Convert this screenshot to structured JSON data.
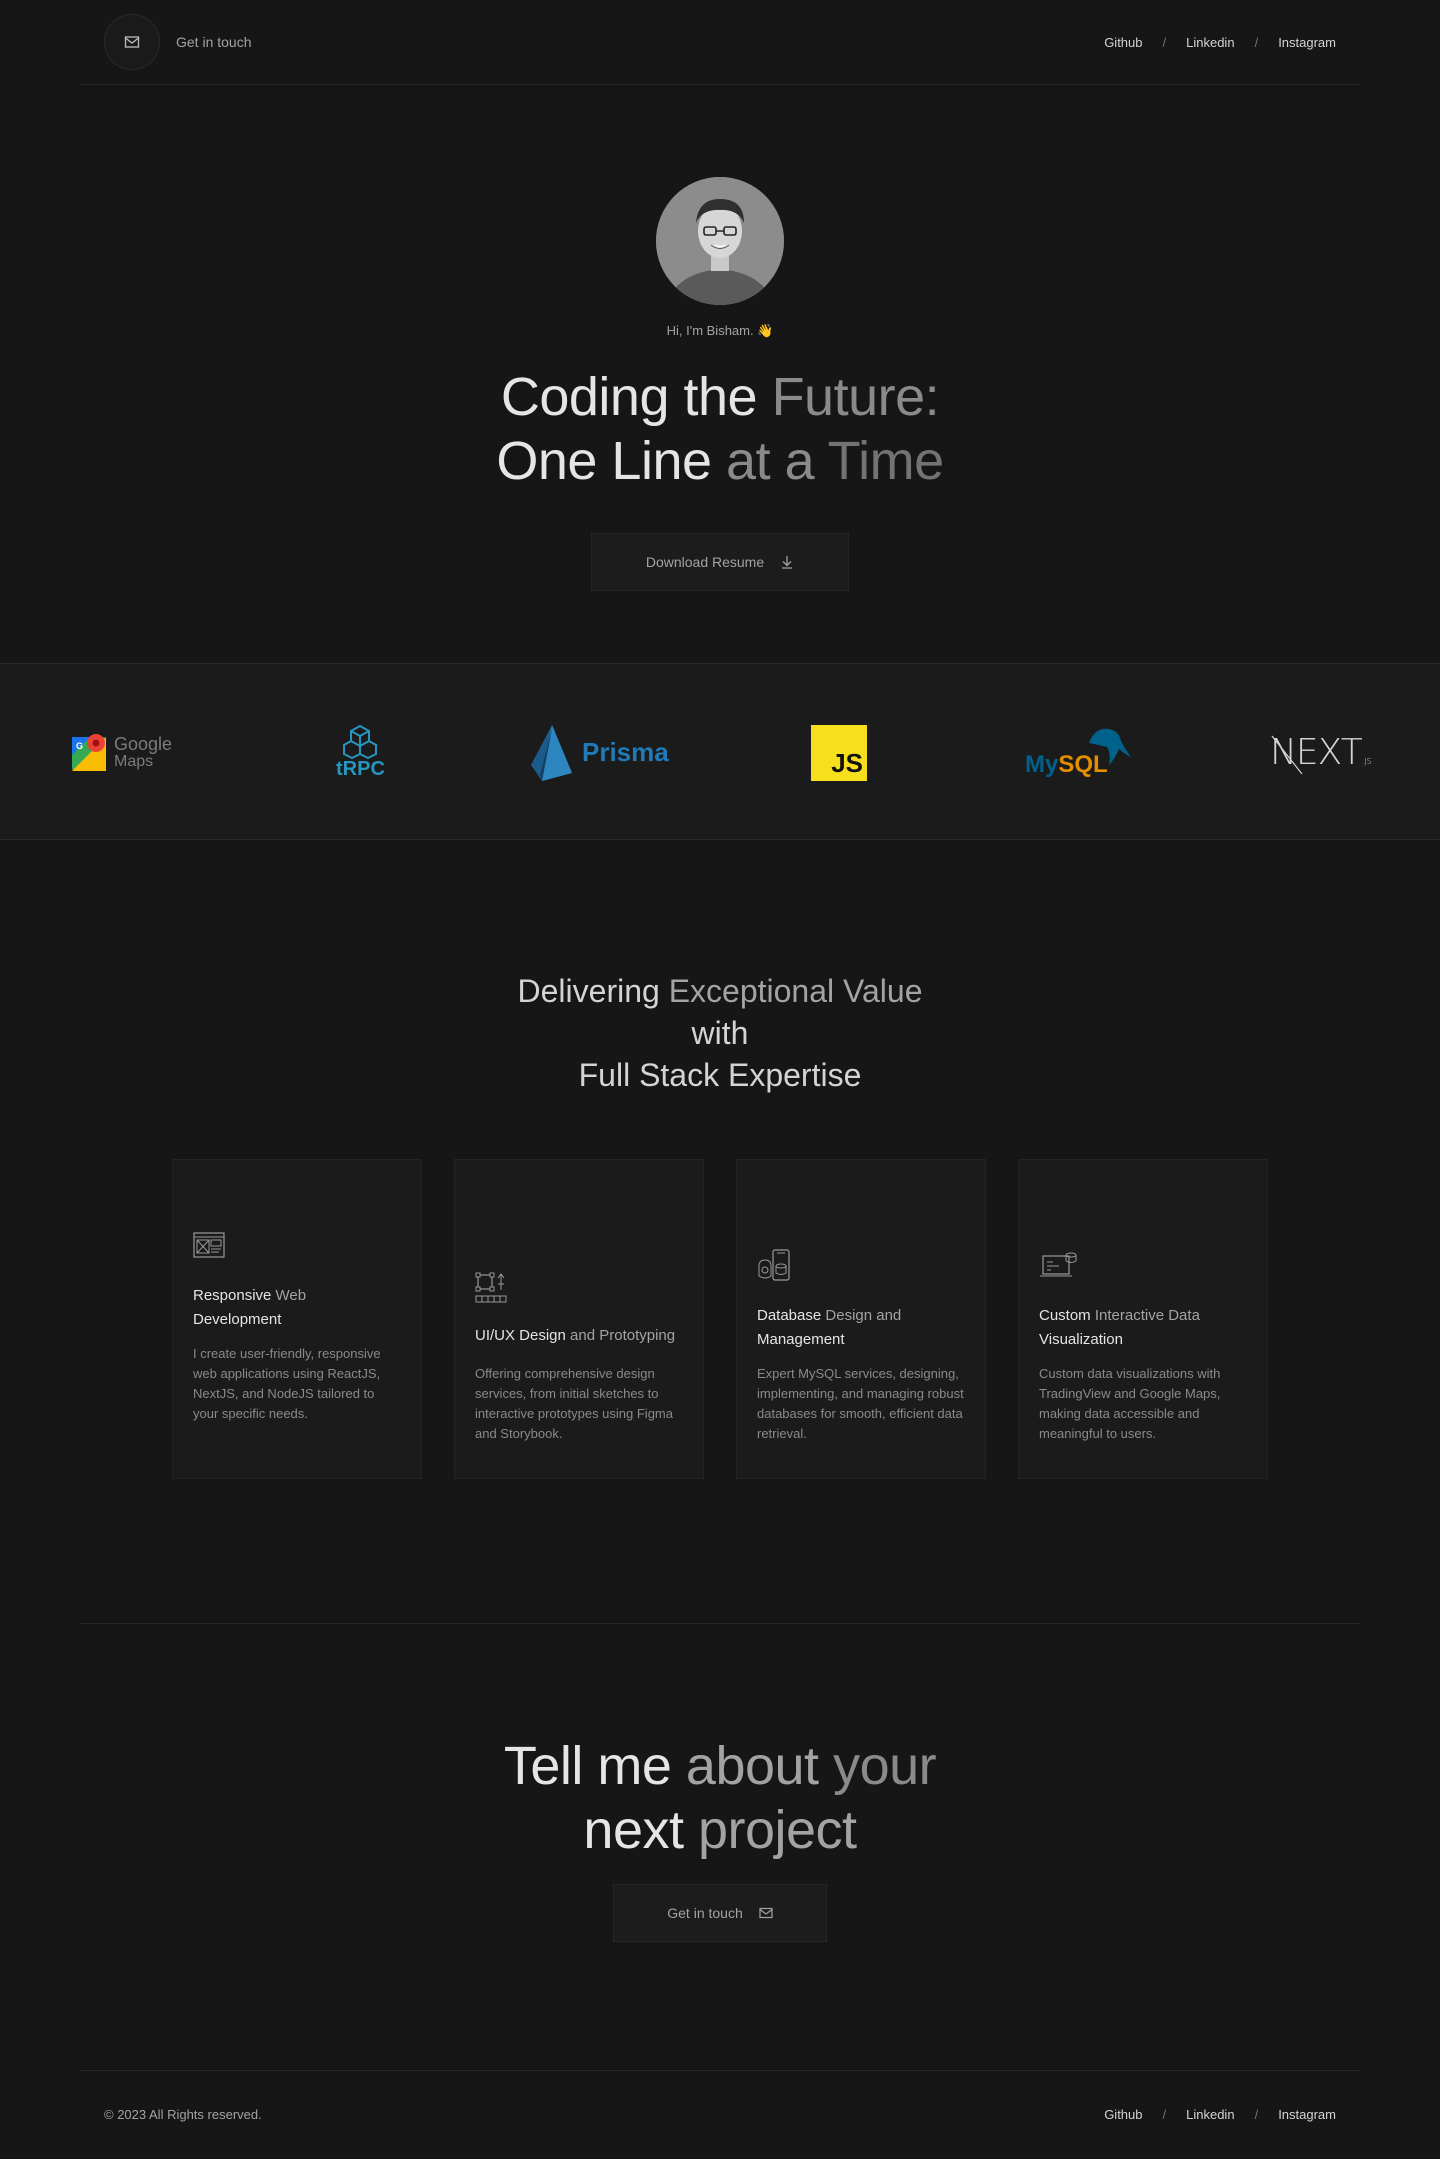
{
  "header": {
    "contact_label": "Get in touch",
    "links": [
      "Github",
      "Linkedin",
      "Instagram"
    ],
    "separator": "/"
  },
  "hero": {
    "greeting": "Hi, I'm Bisham.",
    "wave": "👋",
    "title_line1_a": "Coding the ",
    "title_line1_b": "Future:",
    "title_line2_a": "One Line ",
    "title_line2_b": "at a ",
    "title_line2_c": "Time",
    "resume_button": "Download Resume"
  },
  "logos": [
    {
      "name": "google-maps-logo",
      "text1": "Google",
      "text2": "Maps"
    },
    {
      "name": "trpc-logo",
      "text": "tRPC"
    },
    {
      "name": "prisma-logo",
      "text": "Prisma"
    },
    {
      "name": "javascript-logo",
      "text": "JS"
    },
    {
      "name": "mysql-logo",
      "text_a": "My",
      "text_b": "SQL"
    },
    {
      "name": "nextjs-logo",
      "text": "NEXT",
      "sub": ".JS"
    }
  ],
  "value": {
    "line1_a": "Delivering ",
    "line1_b": "Exceptional Value",
    "line2": "with",
    "line3": "Full Stack Expertise"
  },
  "cards": [
    {
      "title_a": "Responsive ",
      "title_b": "Web",
      "title_c": "Development",
      "desc": "I create user-friendly, responsive web applications using ReactJS, NextJS, and NodeJS tailored to your specific needs."
    },
    {
      "title_a": "UI/UX Design ",
      "title_b": "and Prototyping",
      "desc": "Offering comprehensive design services, from initial sketches to interactive prototypes using Figma and Storybook."
    },
    {
      "title_a": "Database ",
      "title_b": "Design and",
      "title_c": "Management",
      "desc": "Expert MySQL services, designing, implementing, and managing robust databases for smooth, efficient data retrieval."
    },
    {
      "title_a": "Custom ",
      "title_b": "Interactive Data",
      "title_c": "Visualization",
      "desc": "Custom data visualizations with TradingView and Google Maps, making data accessible and meaningful to users."
    }
  ],
  "cta": {
    "line1_a": "Tell me ",
    "line1_b": "about ",
    "line1_c": "your",
    "line2_a": "next ",
    "line2_b": "project",
    "button": "Get in touch"
  },
  "footer": {
    "copyright": "© 2023 All Rights reserved.",
    "links": [
      "Github",
      "Linkedin",
      "Instagram"
    ],
    "separator": "/"
  }
}
